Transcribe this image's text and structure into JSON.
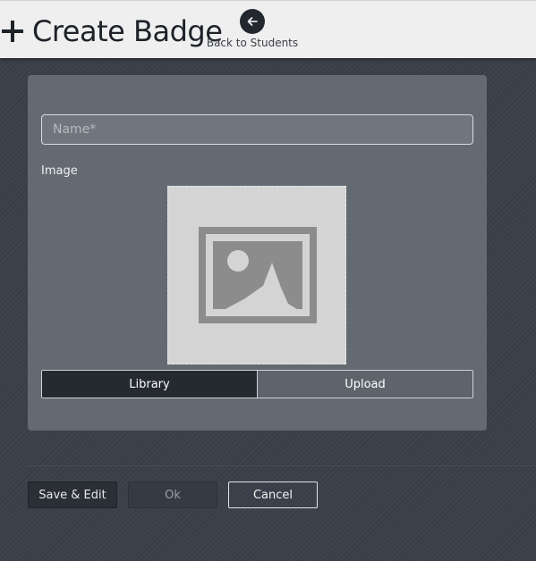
{
  "header": {
    "title": "Create Badge",
    "back_label": "Back to Students"
  },
  "form": {
    "name_placeholder": "Name*",
    "name_value": "",
    "image_label": "Image",
    "image_source_tabs": [
      {
        "label": "Library",
        "selected": true
      },
      {
        "label": "Upload",
        "selected": false
      }
    ]
  },
  "actions": {
    "save_edit_label": "Save & Edit",
    "ok_label": "Ok",
    "cancel_label": "Cancel"
  },
  "icons": {
    "title": "plus-icon",
    "back": "arrow-left-icon",
    "image_placeholder": "image-placeholder-icon"
  },
  "colors": {
    "header_bg": "#efefef",
    "page_bg": "#3a4049",
    "card_bg": "#646a72",
    "dark_accent": "#252a31"
  }
}
